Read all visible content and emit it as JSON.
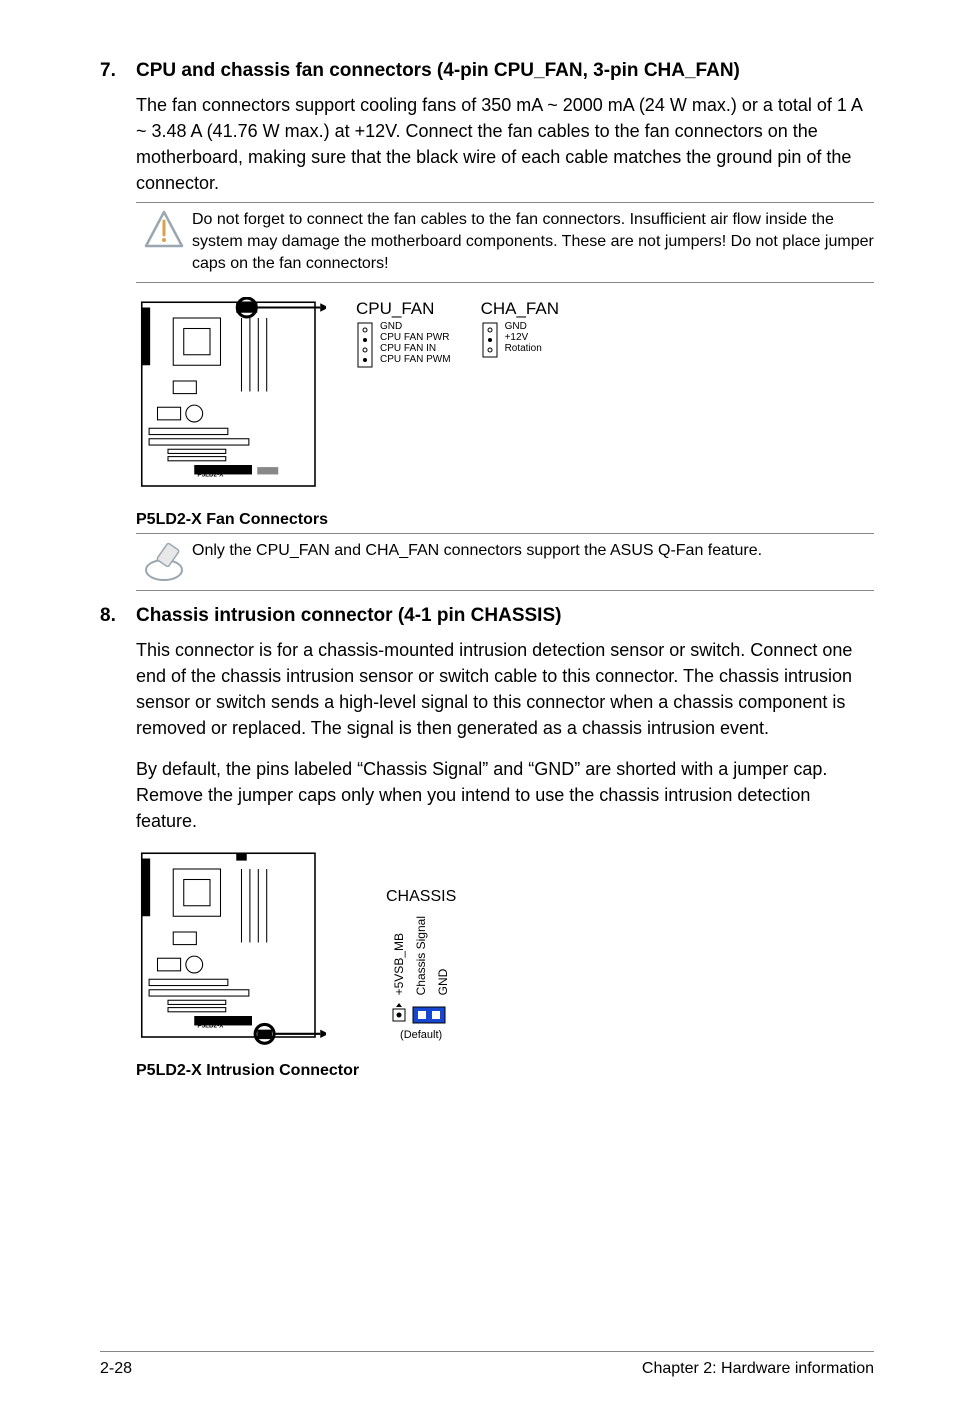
{
  "section7": {
    "num": "7.",
    "title": "CPU and chassis fan connectors (4-pin CPU_FAN, 3-pin CHA_FAN)",
    "body": "The fan connectors support cooling fans of 350 mA ~ 2000 mA (24 W max.) or a total of 1 A ~ 3.48 A (41.76 W max.) at +12V. Connect the fan cables to the fan connectors on the motherboard, making sure that the black wire of each cable matches the ground pin of the connector.",
    "warning": "Do not forget to connect the fan cables to the fan connectors. Insufficient air flow inside the system may damage the motherboard components. These are not jumpers! Do not place jumper caps on the fan connectors!",
    "diagram_caption": "P5LD2-X Fan Connectors",
    "cpu_fan": {
      "title": "CPU_FAN",
      "pins": [
        "GND",
        "CPU FAN PWR",
        "CPU FAN IN",
        "CPU FAN PWM"
      ]
    },
    "cha_fan": {
      "title": "CHA_FAN",
      "pins": [
        "GND",
        "+12V",
        "Rotation"
      ]
    },
    "note": "Only the CPU_FAN and CHA_FAN connectors support the ASUS Q-Fan feature."
  },
  "section8": {
    "num": "8.",
    "title": "Chassis intrusion connector (4-1 pin CHASSIS)",
    "body1": "This connector is for a chassis-mounted intrusion detection sensor or switch. Connect one end of the chassis intrusion sensor or switch cable to this connector. The chassis intrusion sensor or switch sends a high-level signal to this connector when a chassis component is removed or replaced. The signal is then generated as a chassis intrusion event.",
    "body2": "By default, the pins labeled “Chassis Signal” and “GND” are shorted with a jumper cap. Remove the jumper caps only when you intend to use the chassis intrusion detection feature.",
    "diagram_caption": "P5LD2-X Intrusion Connector",
    "chassis": {
      "title": "CHASSIS",
      "pins": [
        "+5VSB_MB",
        "Chassis Signal",
        "GND"
      ],
      "default": "(Default)"
    }
  },
  "footer": {
    "left": "2-28",
    "right": "Chapter 2: Hardware information"
  }
}
